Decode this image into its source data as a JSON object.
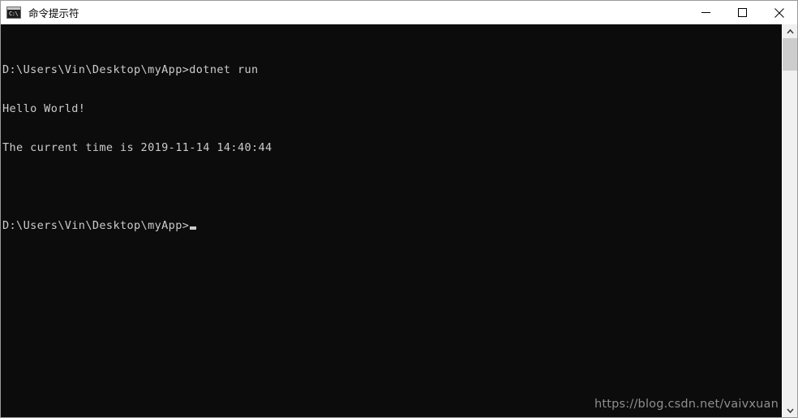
{
  "window": {
    "title": "命令提示符",
    "icon": "cmd-icon",
    "icon_prompt_text": "C:\\",
    "controls": {
      "minimize_label": "—",
      "maximize_label": "□",
      "close_label": "✕",
      "minimize_name": "minimize",
      "maximize_name": "maximize",
      "close_name": "close"
    },
    "border_color": "#9a9a9a",
    "titlebar_bg": "#ffffff",
    "titlebar_fg": "#000000"
  },
  "console": {
    "background_color": "#0c0c0c",
    "foreground_color": "#cccccc",
    "lines": [
      "D:\\Users\\Vin\\Desktop\\myApp>dotnet run",
      "Hello World!",
      "The current time is 2019-11-14 14:40:44",
      "",
      "D:\\Users\\Vin\\Desktop\\myApp>"
    ],
    "line_1": "D:\\Users\\Vin\\Desktop\\myApp>dotnet run",
    "line_2": "Hello World!",
    "line_3": "The current time is 2019-11-14 14:40:44",
    "line_4": "",
    "line_5": "D:\\Users\\Vin\\Desktop\\myApp>",
    "command": "dotnet run",
    "prompt": "D:\\Users\\Vin\\Desktop\\myApp>",
    "output_text": "Hello World!",
    "timestamp": "2019-11-14 14:40:44",
    "cursor_visible": true
  },
  "watermark": {
    "text": "https://blog.csdn.net/vaivxuan",
    "color": "#8f8f8f"
  },
  "scrollbar": {
    "up_arrow": "▲",
    "down_arrow": "▼",
    "thumb_color": "#cdcdcd",
    "track_color": "#f0f0f0"
  }
}
